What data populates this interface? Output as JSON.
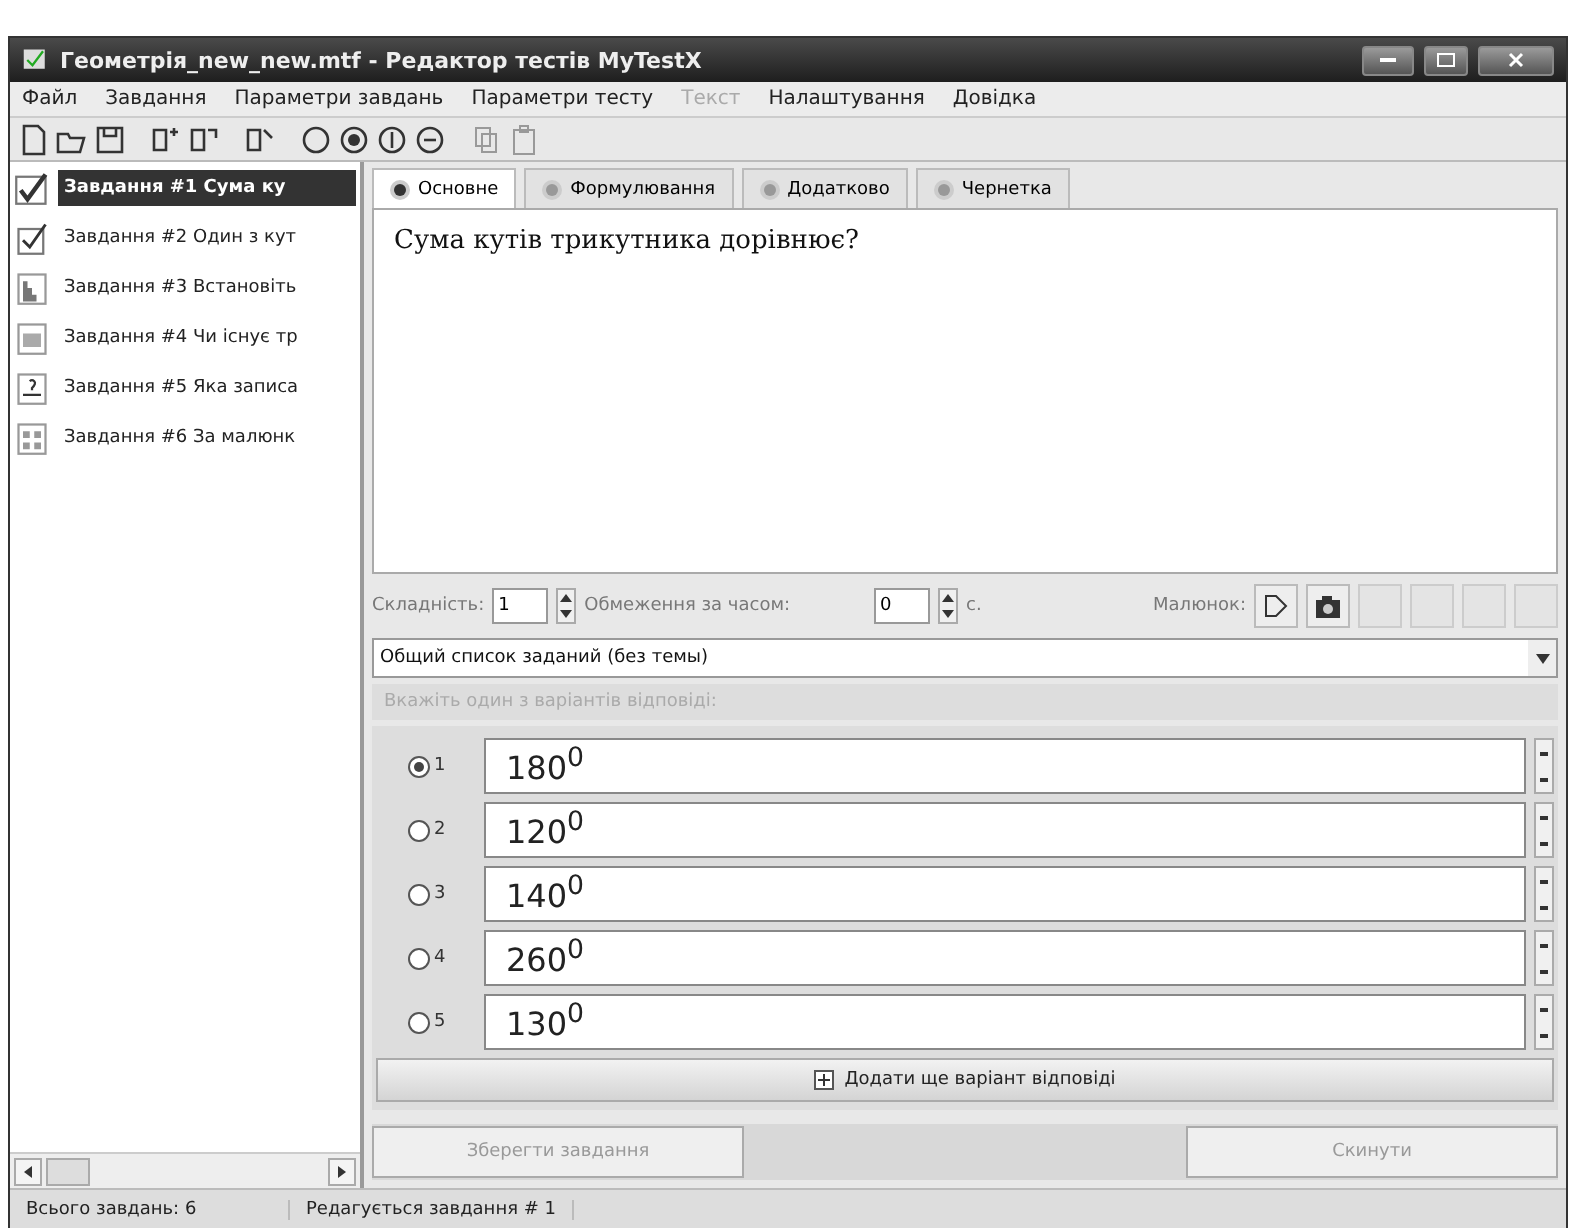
{
  "window": {
    "title": "Геометрія_new_new.mtf - Редактор тестів MyTestX"
  },
  "menu": [
    {
      "label": "Файл",
      "disabled": false
    },
    {
      "label": "Завдання",
      "disabled": false
    },
    {
      "label": "Параметри завдань",
      "disabled": false
    },
    {
      "label": "Параметри тесту",
      "disabled": false
    },
    {
      "label": "Текст",
      "disabled": true
    },
    {
      "label": "Налаштування",
      "disabled": false
    },
    {
      "label": "Довідка",
      "disabled": false
    }
  ],
  "tasks": [
    {
      "label": "Завдання #1 Сума ку",
      "kind": "single",
      "selected": true
    },
    {
      "label": "Завдання #2 Один з кут",
      "kind": "multiple",
      "selected": false
    },
    {
      "label": "Завдання #3 Встановіть",
      "kind": "order",
      "selected": false
    },
    {
      "label": "Завдання #4 Чи існує тр",
      "kind": "text",
      "selected": false
    },
    {
      "label": "Завдання #5 Яка записа",
      "kind": "input",
      "selected": false
    },
    {
      "label": "Завдання #6 За малюнк",
      "kind": "table",
      "selected": false
    }
  ],
  "tabs": [
    {
      "label": "Основне",
      "selected": true
    },
    {
      "label": "Формулювання",
      "selected": false
    },
    {
      "label": "Додатково",
      "selected": false
    },
    {
      "label": "Чернетка",
      "selected": false
    }
  ],
  "question": "Сума кутів трикутника дорівнює?",
  "params": {
    "difficulty_label": "Складність:",
    "difficulty": "1",
    "time_label": "Обмеження за часом:",
    "time": "0",
    "time_unit": "с.",
    "picture_label": "Малюнок:"
  },
  "topic": {
    "value": "Общий список заданий (без темы)"
  },
  "hint": "Вкажіть один з варіантів відповіді:",
  "answers": [
    {
      "number": "1",
      "text": "180$^{0}$",
      "selected": true
    },
    {
      "number": "2",
      "text": "120$^{0}$",
      "selected": false
    },
    {
      "number": "3",
      "text": "140$^{0}$",
      "selected": false
    },
    {
      "number": "4",
      "text": "260$^{0}$",
      "selected": false
    },
    {
      "number": "5",
      "text": "130$^{0}$",
      "selected": false
    }
  ],
  "add_button": "Додати ще варіант відповіді",
  "save_button": {
    "label": "Зберегти завдання",
    "disabled": true
  },
  "cancel_button": {
    "label": "Скинути",
    "disabled": true
  },
  "status_bar": [
    "Всього завдань: 6",
    "Редагується завдання # 1"
  ]
}
